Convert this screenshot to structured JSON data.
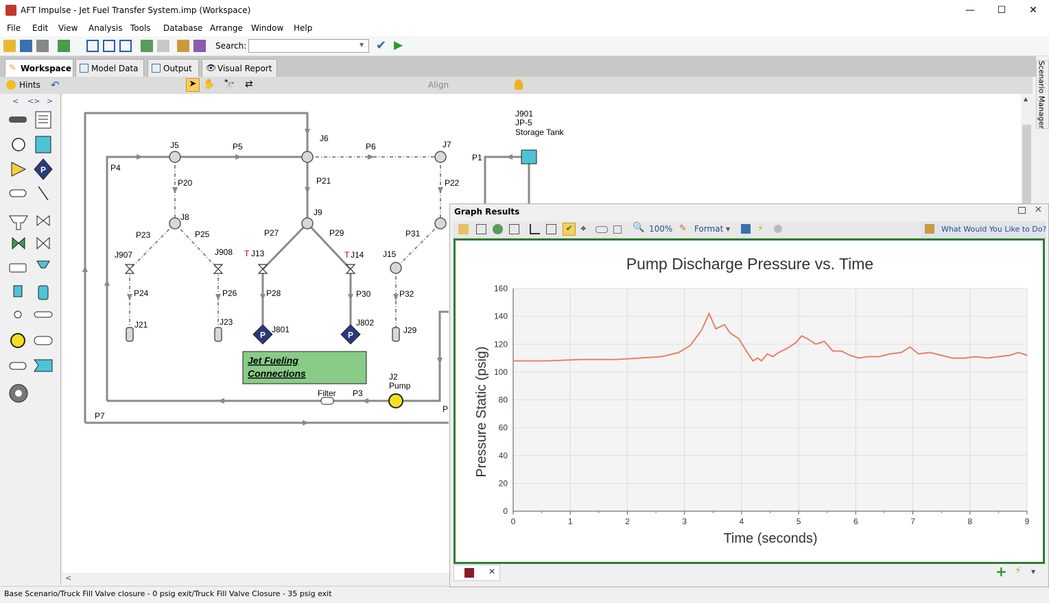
{
  "window": {
    "title": "AFT Impulse - Jet Fuel Transfer System.imp (Workspace)",
    "minimize": "—",
    "maximize": "☐",
    "close": "✕"
  },
  "menu": [
    "File",
    "Edit",
    "View",
    "Analysis",
    "Tools",
    "Database",
    "Arrange",
    "Window",
    "Help"
  ],
  "toolbar": {
    "search_label": "Search:",
    "search_value": ""
  },
  "tabs": [
    "Workspace",
    "Model Data",
    "Output",
    "Visual Report"
  ],
  "workspace_toolbar": {
    "hints": "Hints",
    "align": "Align"
  },
  "palette": {
    "nav": [
      "<",
      "<>",
      ">"
    ]
  },
  "scenario_manager": "Scenario Manager",
  "status": "Base Scenario/Truck Fill Valve closure - 0 psig exit/Truck Fill Valve Closure - 35 psig exit",
  "model": {
    "junctions": [
      "J5",
      "J6",
      "J7",
      "J8",
      "J9",
      "J15",
      "J21",
      "J23",
      "J29",
      "J801",
      "J802",
      "J907",
      "J908",
      "J13",
      "J14",
      "J901",
      "JP-5",
      "Storage Tank",
      "J2",
      "Pump",
      "Filter"
    ],
    "pipes": [
      "P1",
      "P3",
      "P4",
      "P5",
      "P6",
      "P7",
      "P20",
      "P21",
      "P22",
      "P23",
      "P24",
      "P25",
      "P26",
      "P27",
      "P28",
      "P29",
      "P30",
      "P31",
      "P32",
      "P"
    ],
    "annotation": [
      "Jet Fueling",
      "Connections"
    ],
    "T": "T"
  },
  "graph": {
    "panel_title": "Graph Results",
    "zoom": "100%",
    "format": "Format",
    "help": "What Would You Like to Do?"
  },
  "chart_data": {
    "type": "line",
    "title": "Pump Discharge Pressure vs. Time",
    "xlabel": "Time (seconds)",
    "ylabel": "Pressure Static (psig)",
    "xlim": [
      0,
      9
    ],
    "ylim": [
      0,
      160
    ],
    "xticks": [
      0,
      1,
      2,
      3,
      4,
      5,
      6,
      7,
      8,
      9
    ],
    "yticks": [
      0,
      20,
      40,
      60,
      80,
      100,
      120,
      140,
      160
    ],
    "grid": true,
    "color": "#e8806a",
    "series": [
      {
        "x": [
          0,
          0.6,
          1.2,
          1.8,
          2.2,
          2.6,
          2.9,
          3.1,
          3.3,
          3.43,
          3.55,
          3.7,
          3.8,
          3.95,
          4.1,
          4.2,
          4.28,
          4.35,
          4.45,
          4.55,
          4.65,
          4.8,
          4.95,
          5.05,
          5.15,
          5.3,
          5.45,
          5.6,
          5.75,
          5.9,
          6.05,
          6.2,
          6.4,
          6.6,
          6.8,
          6.95,
          7.1,
          7.3,
          7.5,
          7.7,
          7.9,
          8.1,
          8.3,
          8.5,
          8.7,
          8.85,
          9.0
        ],
        "y": [
          108,
          108,
          109,
          109,
          110,
          111,
          114,
          119,
          130,
          142,
          131,
          134,
          128,
          124,
          114,
          108,
          110,
          108,
          113,
          111,
          114,
          117,
          121,
          126,
          124,
          120,
          122,
          115,
          115,
          112,
          110,
          111,
          111,
          113,
          114,
          118,
          113,
          114,
          112,
          110,
          110,
          111,
          110,
          111,
          112,
          114,
          112
        ]
      }
    ]
  }
}
